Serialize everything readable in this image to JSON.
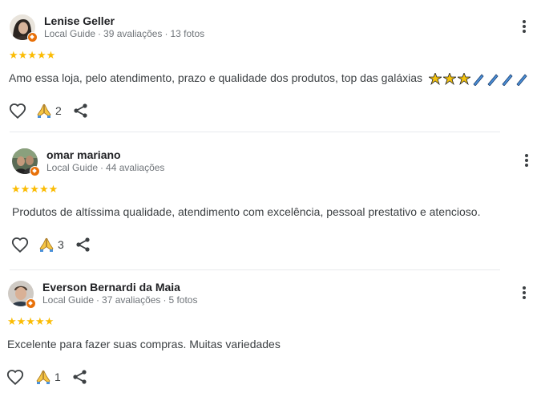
{
  "reviews": [
    {
      "author": "Lenise Geller",
      "badge": "Local Guide",
      "reviews_count": "39 avaliações",
      "photos_count": "13 fotos",
      "rating": "★★★★★",
      "text": "Amo essa loja, pelo atendimento, prazo e qualidade dos produtos, top das galáxias",
      "helpful_count": "2"
    },
    {
      "author": "omar mariano",
      "badge": "Local Guide",
      "reviews_count": "44 avaliações",
      "photos_count": "",
      "rating": "★★★★★",
      "text": "Produtos de altíssima qualidade, atendimento com excelência, pessoal prestativo e atencioso.",
      "helpful_count": "3"
    },
    {
      "author": "Everson Bernardi da Maia",
      "badge": "Local Guide",
      "reviews_count": "37 avaliações",
      "photos_count": "5 fotos",
      "rating": "★★★★★",
      "text": "Excelente para fazer suas compras. Muitas variedades",
      "helpful_count": "1"
    }
  ],
  "colors": {
    "star": "#fbbc04",
    "badge": "#e8710a",
    "meta": "#70757a"
  },
  "icons": [
    "heart-outline-icon",
    "folded-hands-icon",
    "share-icon",
    "more-vert-icon",
    "local-guide-badge-icon"
  ]
}
